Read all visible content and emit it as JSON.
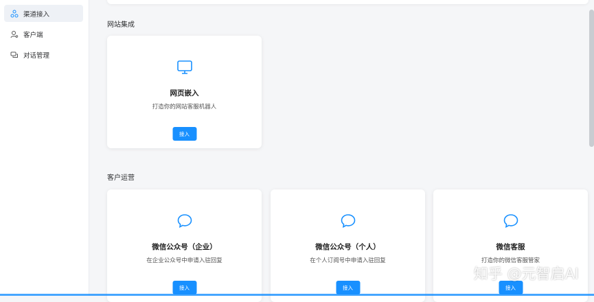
{
  "sidebar": {
    "items": [
      {
        "label": "渠道接入",
        "icon": "channel-nodes-icon",
        "active": true
      },
      {
        "label": "客户端",
        "icon": "user-client-icon",
        "active": false
      },
      {
        "label": "对话管理",
        "icon": "chat-bubbles-icon",
        "active": false
      }
    ]
  },
  "sections": [
    {
      "title": "网站集成",
      "cards": [
        {
          "title": "网页嵌入",
          "desc": "打造你的网站客服机器人",
          "button": "接入",
          "icon": "monitor-icon"
        }
      ]
    },
    {
      "title": "客户运营",
      "cards": [
        {
          "title": "微信公众号（企业）",
          "desc": "在企业公众号中申请入驻回复",
          "button": "接入",
          "icon": "chat-bubble-icon"
        },
        {
          "title": "微信公众号（个人）",
          "desc": "在个人订阅号中申请入驻回复",
          "button": "接入",
          "icon": "chat-bubble-icon"
        },
        {
          "title": "微信客服",
          "desc": "打造你的微信客服管家",
          "button": "接入",
          "icon": "chat-bubble-icon"
        }
      ]
    }
  ],
  "watermark": "知乎 @元智启AI",
  "colors": {
    "accent": "#1890ff",
    "icon": "#1890ff"
  }
}
